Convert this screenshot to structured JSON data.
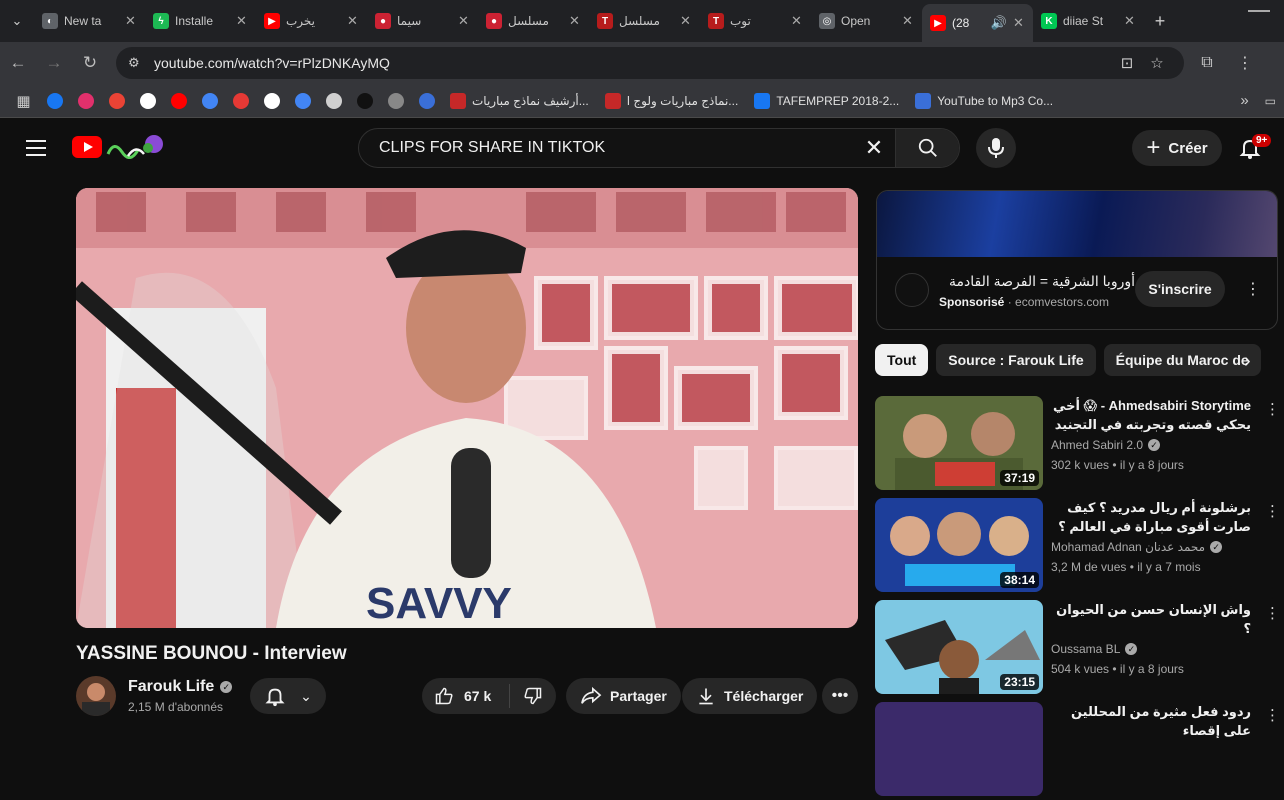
{
  "browser": {
    "tabs": [
      {
        "title": "New ta",
        "fav_color": "#5f6368",
        "fav_glyph": "◐"
      },
      {
        "title": "Installe",
        "fav_color": "#1db954",
        "fav_glyph": "ϟ"
      },
      {
        "title": "يخرب",
        "fav_color": "#ff0000",
        "fav_glyph": "▶"
      },
      {
        "title": "سيما",
        "fav_color": "#cc2233",
        "fav_glyph": "●"
      },
      {
        "title": "مسلسل",
        "fav_color": "#cc2233",
        "fav_glyph": "●"
      },
      {
        "title": "مسلسل",
        "fav_color": "#b71c1c",
        "fav_glyph": "T"
      },
      {
        "title": "توب",
        "fav_color": "#b71c1c",
        "fav_glyph": "T"
      },
      {
        "title": "Open",
        "fav_color": "#5f6368",
        "fav_glyph": "◎"
      },
      {
        "title": "(28",
        "fav_color": "#ff0000",
        "fav_glyph": "▶",
        "active": true
      },
      {
        "title": "diiae St",
        "fav_color": "#00c853",
        "fav_glyph": "K"
      }
    ],
    "url": "youtube.com/watch?v=rPlzDNKAyMQ",
    "bookmarks": {
      "icon_colors": [
        "#1877f2",
        "#e1306c",
        "#ea4335",
        "#ffffff",
        "#ff0000",
        "#4285f4",
        "#e53935",
        "#ffffff",
        "#4285f4",
        "#d0d0d0",
        "#111111",
        "#888888",
        "#3a6fd8"
      ],
      "items": [
        {
          "label": "أرشيف نماذج مباريات...",
          "color": "#c62828"
        },
        {
          "label": "نماذج مباريات ولوج ا...",
          "color": "#c62828"
        },
        {
          "label": "TAFEMPREP 2018-2...",
          "color": "#1877f2"
        },
        {
          "label": "YouTube to Mp3 Co...",
          "color": "#3a6fd8"
        }
      ]
    }
  },
  "header": {
    "search_query": "CLIPS FOR SHARE IN TIKTOK",
    "create_label": "Créer",
    "notif_badge": "9+"
  },
  "video": {
    "title": "YASSINE BOUNOU - Interview",
    "channel": "Farouk Life",
    "subscribers": "2,15 M d'abonnés",
    "likes": "67 k",
    "share_label": "Partager",
    "download_label": "Télécharger"
  },
  "ad": {
    "title": "أوروبا الشرقية = الفرصة القادمة",
    "sponsored": "Sponsorisé",
    "domain": "ecomvestors.com",
    "subscribe_label": "S'inscrire"
  },
  "chips": [
    "Tout",
    "Source : Farouk Life",
    "Équipe du Maroc de"
  ],
  "recommendations": [
    {
      "title": "Ahmedsabiri Storytime - 😱 أخي يحكي قصته وتجربته في التجنيد شاف جنون",
      "channel": "Ahmed Sabiri 2.0",
      "meta": "302 k vues • il y a 8 jours",
      "duration": "37:19"
    },
    {
      "title": "برشلونة أم ريال مدريد ؟ كيف صارت أقوى مباراة في العالم ؟ - القصة الكاملة 🔥",
      "channel": "Mohamad Adnan محمد عدنان",
      "meta": "3,2 M de vues • il y a 7 mois",
      "duration": "38:14"
    },
    {
      "title": "واش الإنسان حسن من الحيوان ؟",
      "channel": "Oussama BL",
      "meta": "504 k vues • il y a 8 jours",
      "duration": "23:15"
    },
    {
      "title": "ردود فعل مثيرة من المحللين على إقصاء",
      "channel": "",
      "meta": "",
      "duration": ""
    }
  ]
}
